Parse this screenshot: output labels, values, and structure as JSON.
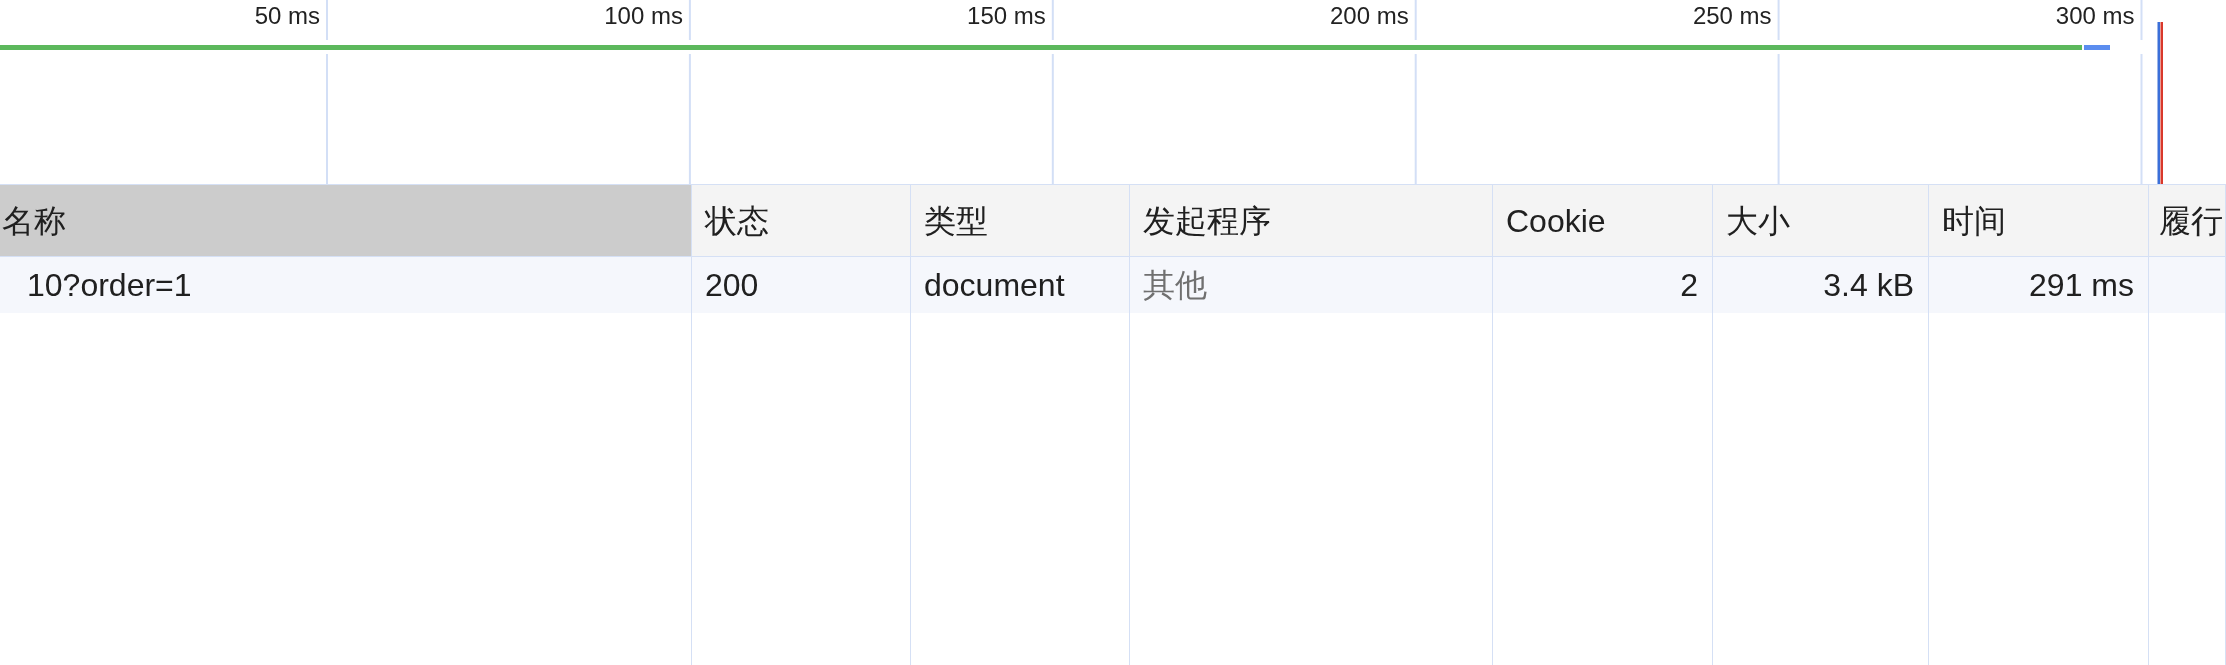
{
  "timeline": {
    "tick_labels": [
      "50 ms",
      "100 ms",
      "150 ms",
      "200 ms",
      "250 ms",
      "300 ms"
    ]
  },
  "table": {
    "columns": [
      {
        "label": "名称",
        "highlighted": true
      },
      {
        "label": "状态",
        "highlighted": false
      },
      {
        "label": "类型",
        "highlighted": false
      },
      {
        "label": "发起程序",
        "highlighted": false
      },
      {
        "label": "Cookie",
        "highlighted": false
      },
      {
        "label": "大小",
        "highlighted": false
      },
      {
        "label": "时间",
        "highlighted": false
      },
      {
        "label": "履行",
        "highlighted": false
      }
    ],
    "rows": [
      {
        "cells": [
          {
            "text": "10?order=1",
            "dimmed": false
          },
          {
            "text": "200",
            "dimmed": false
          },
          {
            "text": "document",
            "dimmed": false
          },
          {
            "text": "其他",
            "dimmed": true
          },
          {
            "text": "2",
            "dimmed": false
          },
          {
            "text": "3.4 kB",
            "dimmed": false
          },
          {
            "text": "291 ms",
            "dimmed": false
          }
        ]
      }
    ]
  }
}
